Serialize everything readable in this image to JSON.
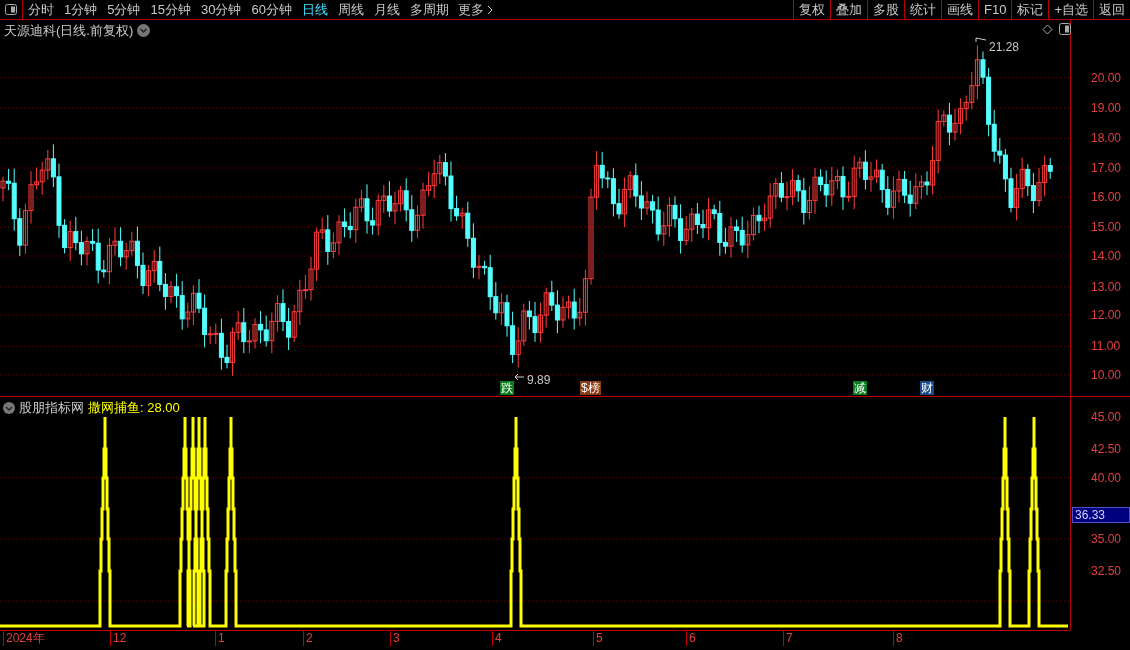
{
  "toolbar": {
    "periods": [
      {
        "label": "分时",
        "selected": false
      },
      {
        "label": "1分钟",
        "selected": false
      },
      {
        "label": "5分钟",
        "selected": false
      },
      {
        "label": "15分钟",
        "selected": false
      },
      {
        "label": "30分钟",
        "selected": false
      },
      {
        "label": "60分钟",
        "selected": false
      },
      {
        "label": "日线",
        "selected": true
      },
      {
        "label": "周线",
        "selected": false
      },
      {
        "label": "月线",
        "selected": false
      },
      {
        "label": "多周期",
        "selected": false
      }
    ],
    "more": "更多",
    "actions": [
      "复权",
      "叠加",
      "多股",
      "统计",
      "画线",
      "F10",
      "标记",
      "+自选",
      "返回"
    ]
  },
  "chart": {
    "title": "天源迪科(日线.前复权)",
    "price_axis": [
      "20.00",
      "19.00",
      "18.00",
      "17.00",
      "16.00",
      "15.00",
      "14.00",
      "13.00",
      "12.00",
      "11.00",
      "10.00"
    ],
    "high_label": "21.28",
    "low_label": "9.89",
    "events": [
      {
        "label": "跌",
        "color": "#0b7d1e"
      },
      {
        "label": "$榜",
        "color": "#8a3c12"
      },
      {
        "label": "减",
        "color": "#0b7d1e"
      },
      {
        "label": "财",
        "color": "#1a4a86"
      }
    ]
  },
  "indicator": {
    "source": "股朋指标网",
    "name": "撒网捕鱼",
    "value": ": 28.00",
    "axis": [
      "45.00",
      "42.50",
      "40.00",
      "35.00",
      "32.50"
    ],
    "current": "36.33"
  },
  "time_axis": [
    "2024年",
    "12",
    "1",
    "2",
    "3",
    "4",
    "5",
    "6",
    "7",
    "8"
  ]
}
